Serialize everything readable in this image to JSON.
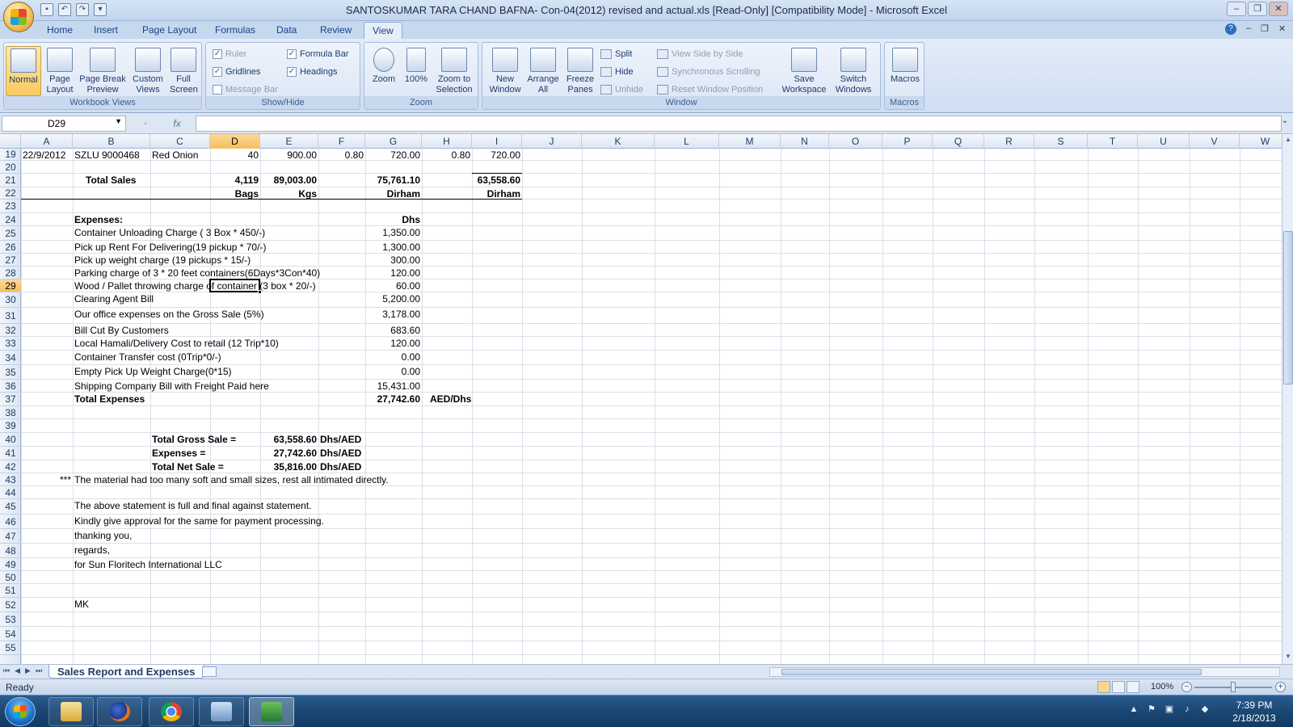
{
  "window": {
    "title": "SANTOSKUMAR TARA CHAND BAFNA- Con-04(2012) revised and actual.xls  [Read-Only]  [Compatibility Mode] - Microsoft Excel"
  },
  "ribbon_tabs": [
    "Home",
    "Insert",
    "Page Layout",
    "Formulas",
    "Data",
    "Review",
    "View"
  ],
  "active_tab": "View",
  "ribbon": {
    "workbook_views": {
      "label": "Workbook Views",
      "buttons": [
        "Normal",
        "Page Layout",
        "Page Break Preview",
        "Custom Views",
        "Full Screen"
      ]
    },
    "show_hide": {
      "label": "Show/Hide",
      "ruler": "Ruler",
      "gridlines": "Gridlines",
      "message_bar": "Message Bar",
      "formula_bar": "Formula Bar",
      "headings": "Headings"
    },
    "zoom": {
      "label": "Zoom",
      "zoom": "Zoom",
      "hundred": "100%",
      "zoom_to_selection": "Zoom to Selection"
    },
    "window": {
      "label": "Window",
      "new_window": "New Window",
      "arrange_all": "Arrange All",
      "freeze_panes": "Freeze Panes",
      "split": "Split",
      "hide": "Hide",
      "unhide": "Unhide",
      "view_side_by_side": "View Side by Side",
      "sync_scrolling": "Synchronous Scrolling",
      "reset_window": "Reset Window Position",
      "save_workspace": "Save Workspace",
      "switch_windows": "Switch Windows"
    },
    "macros": {
      "label": "Macros",
      "macros": "Macros"
    }
  },
  "formula_bar": {
    "name_box": "D29",
    "fx": "fx",
    "value": ""
  },
  "columns": [
    "A",
    "B",
    "C",
    "D",
    "E",
    "F",
    "G",
    "H",
    "I",
    "J",
    "K",
    "L",
    "M",
    "N",
    "O",
    "P",
    "Q",
    "R",
    "S",
    "T",
    "U",
    "V",
    "W"
  ],
  "selected_column": "D",
  "rows": [
    "19",
    "20",
    "21",
    "22",
    "23",
    "24",
    "25",
    "26",
    "27",
    "28",
    "29",
    "30",
    "31",
    "32",
    "33",
    "34",
    "35",
    "36",
    "37",
    "38",
    "39",
    "40",
    "41",
    "42",
    "43",
    "44",
    "45",
    "46",
    "47",
    "48",
    "49",
    "50",
    "51",
    "52",
    "53",
    "54",
    "55"
  ],
  "selected_row": "29",
  "cells": {
    "r19": {
      "a": "22/9/2012",
      "b": "SZLU 9000468",
      "c": "Red Onion",
      "d": "40",
      "e": "900.00",
      "f": "0.80",
      "g": "720.00",
      "h": "0.80",
      "i": "720.00"
    },
    "r21": {
      "b": "Total Sales",
      "d": "4,119",
      "e": "89,003.00",
      "g": "75,761.10",
      "i": "63,558.60"
    },
    "r22": {
      "d": "Bags",
      "e": "Kgs",
      "g": "Dirham",
      "i": "Dirham"
    },
    "r24": {
      "b": "Expenses:",
      "g": "Dhs"
    },
    "expenses": [
      {
        "label": "Container Unloading Charge ( 3 Box * 450/-)",
        "amount": "1,350.00"
      },
      {
        "label": "Pick up Rent For Delivering(19 pickup * 70/-)",
        "amount": "1,300.00"
      },
      {
        "label": "Pick up weight charge (19 pickups * 15/-)",
        "amount": "300.00"
      },
      {
        "label": "Parking charge of 3 * 20 feet containers(6Days*3Con*40)",
        "amount": "120.00"
      },
      {
        "label": "Wood / Pallet throwing charge of container (3 box * 20/-)",
        "amount": "60.00"
      },
      {
        "label": "Clearing Agent Bill",
        "amount": "5,200.00"
      },
      {
        "label": "Our office expenses on the Gross Sale (5%)",
        "amount": "3,178.00"
      },
      {
        "label": "Bill Cut By Customers",
        "amount": "683.60"
      },
      {
        "label": "Local Hamali/Delivery Cost to retail (12 Trip*10)",
        "amount": "120.00"
      },
      {
        "label": "Container Transfer cost (0Trip*0/-)",
        "amount": "0.00"
      },
      {
        "label": "Empty Pick Up Weight Charge(0*15)",
        "amount": "0.00"
      },
      {
        "label": "Shipping Company Bill with Freight Paid here",
        "amount": "15,431.00"
      }
    ],
    "r37": {
      "b": "Total Expenses",
      "g": "27,742.60",
      "h": "AED/Dhs"
    },
    "r40": {
      "c": "Total Gross Sale =",
      "e": "63,558.60",
      "f": "Dhs/AED"
    },
    "r41": {
      "c": "Expenses =",
      "e": "27,742.60",
      "f": "Dhs/AED"
    },
    "r42": {
      "c": "Total Net Sale =",
      "e": "35,816.00",
      "f": "Dhs/AED"
    },
    "r43": {
      "a": "***",
      "b": "The material had too many soft and small sizes, rest all intimated directly."
    },
    "r45": {
      "b": "The above statement is full and final against statement."
    },
    "r46": {
      "b": "Kindly give approval for the same for payment processing."
    },
    "r47": {
      "b": "thanking you,"
    },
    "r48": {
      "b": "regards,"
    },
    "r49": {
      "b": "for Sun Floritech International LLC"
    },
    "r52": {
      "b": "MK"
    }
  },
  "sheet_tab": "Sales Report and Expenses",
  "status": {
    "ready": "Ready",
    "zoom": "100%"
  },
  "taskbar": {
    "apps": [
      "explorer-icon",
      "firefox-icon",
      "chrome-icon",
      "control-panel-icon",
      "excel-icon"
    ],
    "time": "7:39 PM",
    "date": "2/18/2013"
  },
  "colors": {
    "accent_selection": "#f6bd5d",
    "ribbon_blue": "#15428b",
    "taskbar": "#1b4774"
  }
}
